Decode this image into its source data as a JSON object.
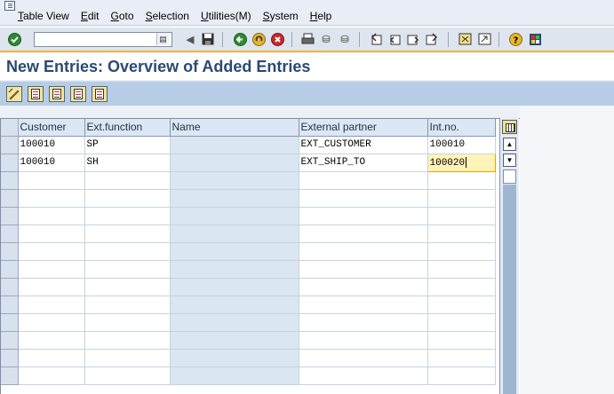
{
  "menu": [
    "Table View",
    "Edit",
    "Goto",
    "Selection",
    "Utilities(M)",
    "System",
    "Help"
  ],
  "toolbar": {
    "command_value": "",
    "icons": [
      "enter-icon",
      "command-dropdown-icon",
      "back-arrow-icon",
      "save-icon",
      "back-icon",
      "exit-icon",
      "cancel-icon",
      "print-icon",
      "find-icon",
      "find-next-icon",
      "first-page-icon",
      "previous-page-icon",
      "next-page-icon",
      "last-page-icon",
      "create-session-icon",
      "shortcut-icon",
      "help-icon",
      "layout-icon"
    ]
  },
  "title": "New Entries: Overview of Added Entries",
  "app_toolbar": {
    "icons": [
      "change-display-icon",
      "copy-as-icon",
      "delete-icon",
      "undo-change-icon",
      "select-all-icon"
    ]
  },
  "table": {
    "columns": [
      "Customer",
      "Ext.function",
      "Name",
      "External partner",
      "Int.no."
    ],
    "rows": [
      [
        "100010",
        "SP",
        "",
        "EXT_CUSTOMER",
        "100010"
      ],
      [
        "100010",
        "SH",
        "",
        "EXT_SHIP_TO",
        "100020"
      ]
    ],
    "empty_rows": 12
  },
  "colors": {
    "title_text": "#2a4a72",
    "app_toolbar_bg": "#b7cde6",
    "toolbar_accent": "#f2b43b",
    "active_cell": "#fff3b8"
  }
}
